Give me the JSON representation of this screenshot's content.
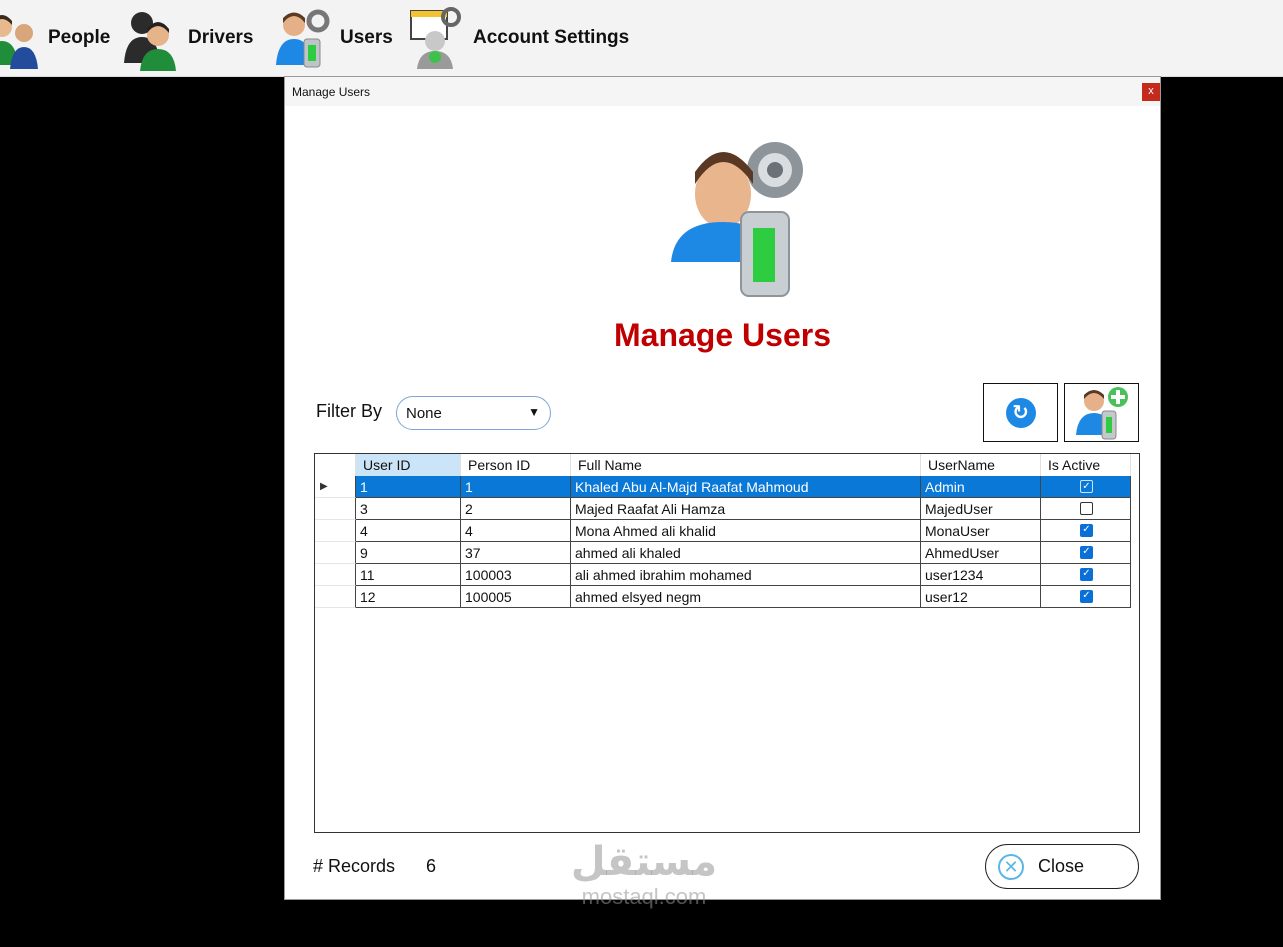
{
  "menu": {
    "items": [
      {
        "label": "People",
        "icon": "people-icon"
      },
      {
        "label": "Drivers",
        "icon": "drivers-icon"
      },
      {
        "label": "Users",
        "icon": "users-icon"
      },
      {
        "label": "Account Settings",
        "icon": "account-settings-icon"
      }
    ]
  },
  "dialog": {
    "window_title": "Manage Users",
    "close_glyph": "x",
    "heading": "Manage Users",
    "heading_color": "#c00000",
    "filter": {
      "label": "Filter By",
      "selected": "None"
    },
    "toolbar": {
      "refresh_icon": "refresh-icon",
      "add_icon": "add-user-icon"
    },
    "grid": {
      "columns": [
        "User ID",
        "Person ID",
        "Full Name",
        "UserName",
        "Is Active"
      ],
      "rows": [
        {
          "user_id": "1",
          "person_id": "1",
          "full_name": "Khaled Abu Al-Majd Raafat Mahmoud",
          "username": "Admin",
          "is_active": true,
          "selected": true
        },
        {
          "user_id": "3",
          "person_id": "2",
          "full_name": "Majed Raafat Ali Hamza",
          "username": "MajedUser",
          "is_active": false,
          "selected": false
        },
        {
          "user_id": "4",
          "person_id": "4",
          "full_name": "Mona Ahmed ali khalid",
          "username": "MonaUser",
          "is_active": true,
          "selected": false
        },
        {
          "user_id": "9",
          "person_id": "37",
          "full_name": "ahmed ali khaled",
          "username": "AhmedUser",
          "is_active": true,
          "selected": false
        },
        {
          "user_id": "11",
          "person_id": "100003",
          "full_name": "ali ahmed ibrahim mohamed",
          "username": "user1234",
          "is_active": true,
          "selected": false
        },
        {
          "user_id": "12",
          "person_id": "100005",
          "full_name": "ahmed elsyed negm",
          "username": "user12",
          "is_active": true,
          "selected": false
        }
      ]
    },
    "records": {
      "label": "# Records",
      "count": "6"
    },
    "close_button": {
      "label": "Close",
      "icon": "close-circle-icon"
    }
  },
  "watermark": {
    "arabic": "مستقل",
    "latin": "mostaql.com"
  },
  "colors": {
    "selection": "#0a78d7",
    "accent": "#1e88e5"
  }
}
